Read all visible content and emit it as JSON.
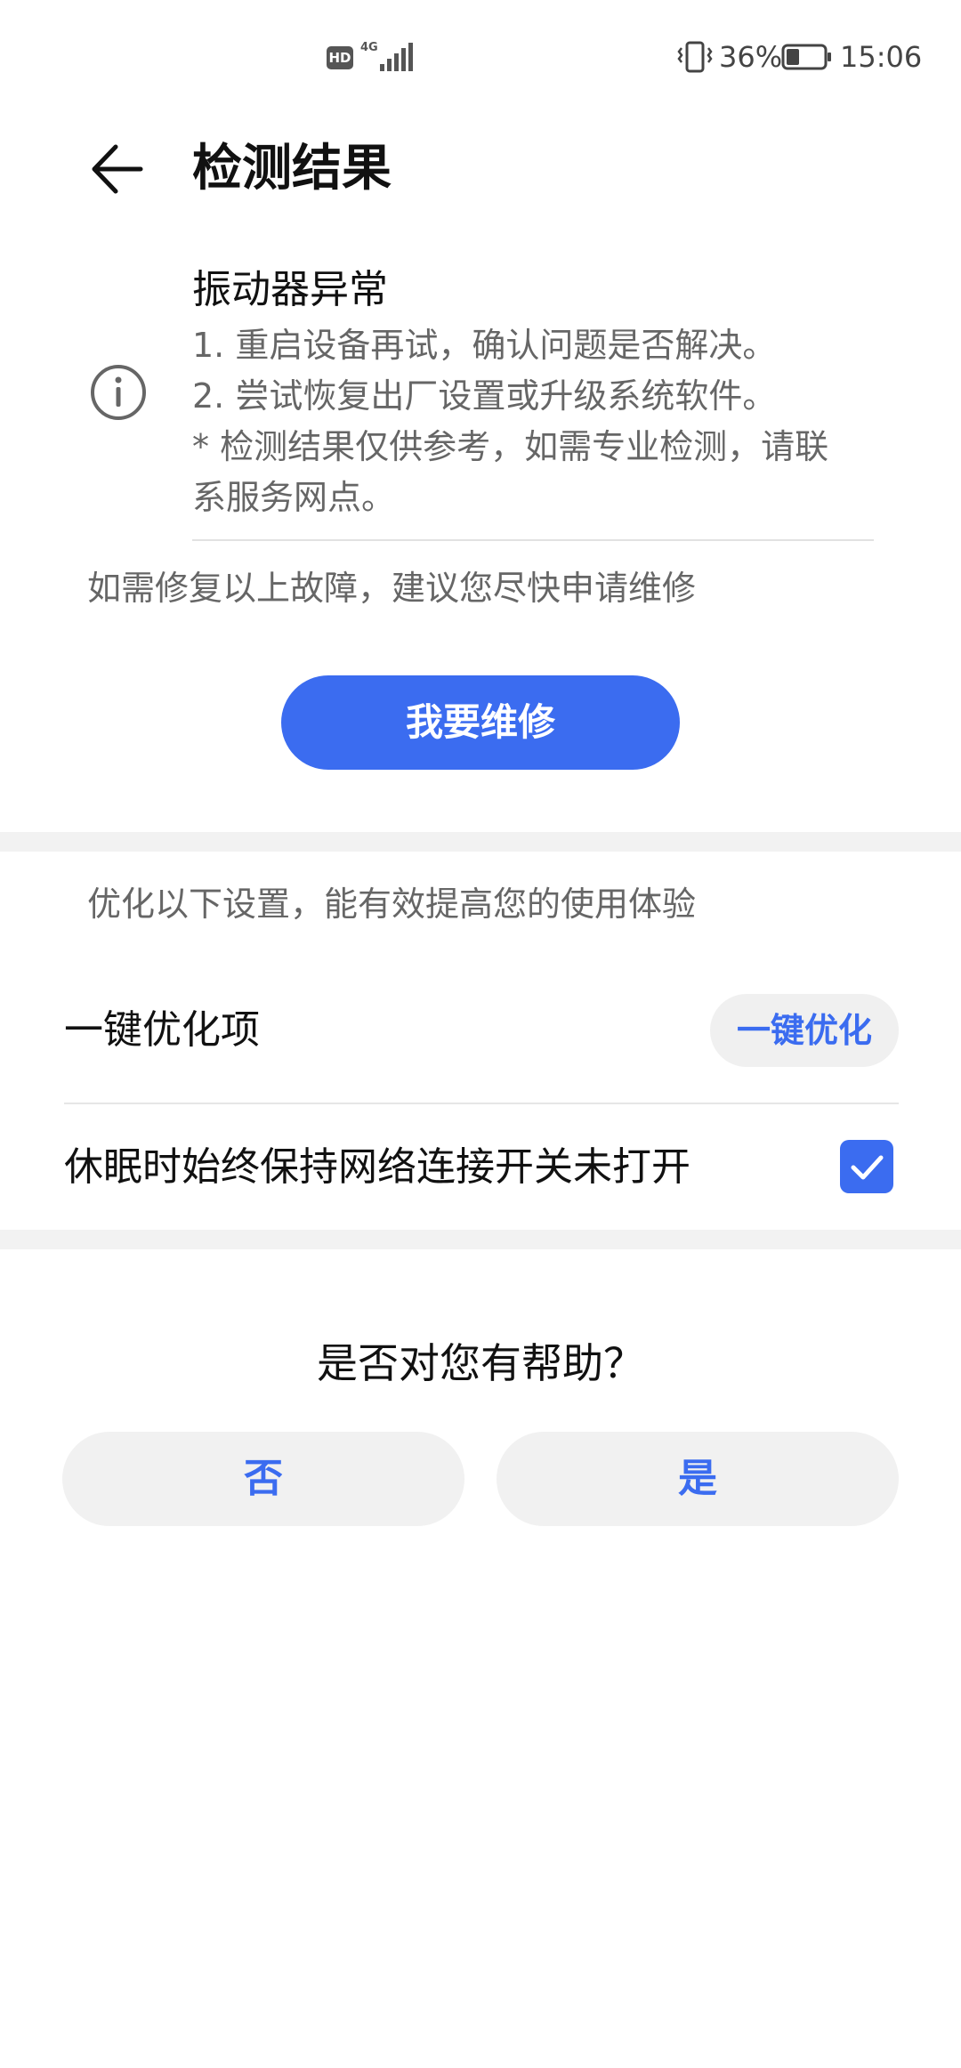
{
  "status_bar": {
    "hd_badge": "HD",
    "network_type": "4G",
    "battery_percent": "36%",
    "battery_level": 0.36,
    "time": "15:06",
    "icons": [
      "signal-icon",
      "vibrate-icon",
      "battery-icon"
    ]
  },
  "header": {
    "title": "检测结果",
    "back_icon": "back-arrow-icon"
  },
  "fault": {
    "icon": "info-icon",
    "title": "振动器异常",
    "steps": [
      "1. 重启设备再试，确认问题是否解决。",
      "2. 尝试恢复出厂设置或升级系统软件。",
      "* 检测结果仅供参考，如需专业检测，请联",
      "系服务网点。"
    ]
  },
  "repair": {
    "hint": "如需修复以上故障，建议您尽快申请维修",
    "button_label": "我要维修"
  },
  "optimize": {
    "hint": "优化以下设置，能有效提高您的使用体验",
    "one_key_label": "一键优化项",
    "one_key_button": "一键优化",
    "items": [
      {
        "label": "休眠时始终保持网络连接开关未打开",
        "checked": true
      }
    ]
  },
  "feedback": {
    "question": "是否对您有帮助？",
    "no_label": "否",
    "yes_label": "是"
  },
  "colors": {
    "accent": "#3b6cf0",
    "secondary_text": "#666666",
    "button_bg": "#f1f1f1"
  }
}
